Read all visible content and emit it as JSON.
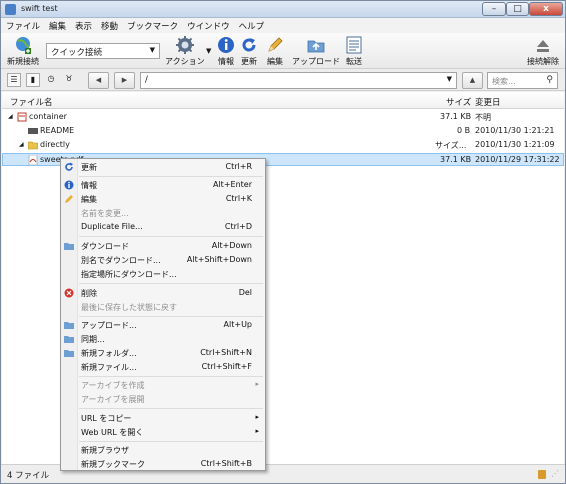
{
  "window": {
    "title": "swift test",
    "minimize": "–",
    "maximize": "□",
    "close": "x"
  },
  "menubar": [
    "ファイル",
    "編集",
    "表示",
    "移動",
    "ブックマーク",
    "ウインドウ",
    "ヘルプ"
  ],
  "toolbar": {
    "new_connection": "新規接続",
    "quick_connect": "クイック接続",
    "action": "アクション",
    "info": "情報",
    "refresh": "更新",
    "edit": "編集",
    "upload": "アップロード",
    "transfer": "転送",
    "disconnect": "接続解除"
  },
  "pathbar": {
    "path": "/",
    "search_placeholder": "検索..."
  },
  "filelist": {
    "columns": {
      "name": "ファイル名",
      "size": "サイズ",
      "modified": "変更日"
    },
    "rows": [
      {
        "name": "container",
        "size": "37.1 KB",
        "modified": "不明"
      },
      {
        "name": "README",
        "size": "0 B",
        "modified": "2010/11/30 1:21:21"
      },
      {
        "name": "directly",
        "size": "サイズ...",
        "modified": "2010/11/30 1:21:09"
      },
      {
        "name": "sweets.pdf",
        "size": "37.1 KB",
        "modified": "2010/11/29 17:31:22"
      }
    ]
  },
  "status": {
    "text": "4 ファイル"
  },
  "context_menu": [
    {
      "label": "更新",
      "shortcut": "Ctrl+R"
    },
    {
      "label": "情報",
      "shortcut": "Alt+Enter"
    },
    {
      "label": "編集",
      "shortcut": "Ctrl+K"
    },
    {
      "label": "名前を変更...",
      "shortcut": ""
    },
    {
      "label": "Duplicate File...",
      "shortcut": "Ctrl+D"
    },
    {
      "label": "ダウンロード",
      "shortcut": "Alt+Down"
    },
    {
      "label": "別名でダウンロード...",
      "shortcut": "Alt+Shift+Down"
    },
    {
      "label": "指定場所にダウンロード...",
      "shortcut": ""
    },
    {
      "label": "削除",
      "shortcut": "Del"
    },
    {
      "label": "最後に保存した状態に戻す",
      "shortcut": ""
    },
    {
      "label": "アップロード...",
      "shortcut": "Alt+Up"
    },
    {
      "label": "同期...",
      "shortcut": ""
    },
    {
      "label": "新規フォルダ...",
      "shortcut": "Ctrl+Shift+N"
    },
    {
      "label": "新規ファイル...",
      "shortcut": "Ctrl+Shift+F"
    },
    {
      "label": "アーカイブを作成",
      "shortcut": ""
    },
    {
      "label": "アーカイブを展開",
      "shortcut": ""
    },
    {
      "label": "URL をコピー",
      "shortcut": ""
    },
    {
      "label": "Web URL を開く",
      "shortcut": ""
    },
    {
      "label": "新規ブラウザ",
      "shortcut": ""
    },
    {
      "label": "新規ブックマーク",
      "shortcut": "Ctrl+Shift+B"
    }
  ]
}
